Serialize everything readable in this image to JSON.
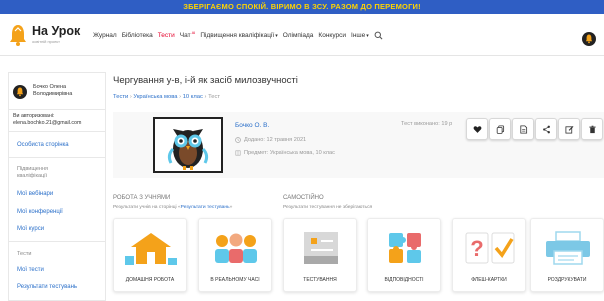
{
  "banner": {
    "text": "ЗБЕРІГАЄМО СПОКІЙ. ВІРИМО В ЗСУ. РАЗОМ ДО ПЕРЕМОГИ!"
  },
  "header": {
    "logo_name": "На Урок",
    "logo_tagline": "освітній проект",
    "nav": [
      {
        "label": "Журнал"
      },
      {
        "label": "Бібліотека"
      },
      {
        "label": "Тести",
        "active": true
      },
      {
        "label": "Чат",
        "badge": "AI"
      },
      {
        "label": "Підвищення кваліфікації",
        "dropdown": true
      },
      {
        "label": "Олімпіада"
      },
      {
        "label": "Конкурси"
      },
      {
        "label": "Інше",
        "dropdown": true
      }
    ],
    "accent_color": "#e4002b",
    "banner_bg": "#2f5ec4",
    "banner_fg": "#ffd400"
  },
  "sidebar": {
    "user_name_line1": "Бочко Олена",
    "user_name_line2": "Володимирівна",
    "auth_label": "Ви авторизовані:",
    "auth_email": "elena.bochko.21@gmail.com",
    "profile_link": "Особиста сторінка",
    "section_qualification_1": "Підвищення",
    "section_qualification_2": "кваліфікації",
    "webinars": "Мої вебінари",
    "conferences": "Мої конференції",
    "courses": "Мої курси",
    "section_tests": "Тести",
    "my_tests": "Мої тести",
    "results": "Результати тестувань"
  },
  "main": {
    "title": "Чергування у-в, і-й як засіб милозвучності",
    "breadcrumb": [
      "Тести",
      "Українська мова",
      "10 клас",
      "Тест"
    ],
    "test": {
      "author": "Бочко О. В.",
      "added": "Додано: 12 травня 2021",
      "subject": "Предмет: Українська мова, 10 клас",
      "completed": "Тест виконано: 19 р"
    },
    "actions": [
      "heart-icon",
      "copy-icon",
      "document-icon",
      "share-icon",
      "edit-icon",
      "delete-icon"
    ],
    "section_students": {
      "title": "РОБОТА З УЧНЯМИ",
      "sub_prefix": "Результати учнів на сторінці «",
      "sub_link": "Результати тестувань",
      "sub_suffix": "»"
    },
    "section_self": {
      "title": "САМОСТІЙНО",
      "sub": "Результати тестування не зберігаються"
    },
    "tiles": [
      {
        "label": "ДОМАШНЯ РОБОТА",
        "icon": "house-icon"
      },
      {
        "label": "В РЕАЛЬНОМУ ЧАСІ",
        "icon": "group-icon"
      },
      {
        "label": "ТЕСТУВАННЯ",
        "icon": "test-icon"
      },
      {
        "label": "ВІДПОВІДНОСТІ",
        "icon": "puzzle-icon"
      },
      {
        "label": "ФЛЕШ-КАРТКИ",
        "icon": "flashcard-icon"
      },
      {
        "label": "РОЗДРУКУВАТИ",
        "icon": "printer-icon"
      }
    ]
  }
}
